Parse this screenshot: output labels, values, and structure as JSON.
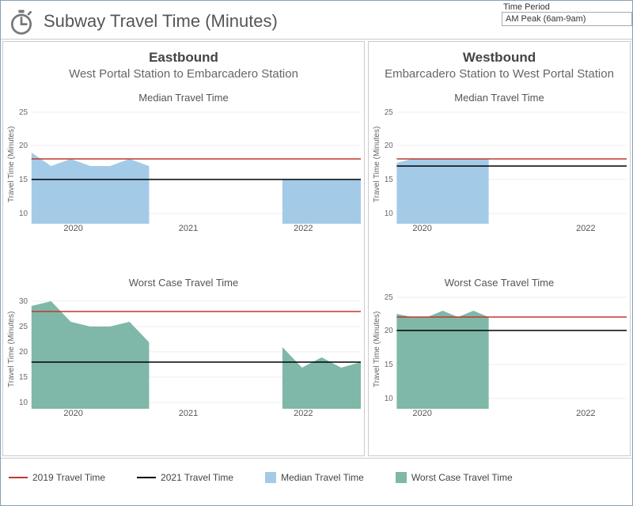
{
  "header": {
    "title": "Subway Travel Time (Minutes)",
    "icon": "stopwatch-icon"
  },
  "period": {
    "label": "Time Period",
    "value": "AM Peak (6am-9am)"
  },
  "panels": {
    "left": {
      "direction": "Eastbound",
      "route": "West Portal Station to Embarcadero Station"
    },
    "right": {
      "direction": "Westbound",
      "route": "Embarcadero Station to West Portal Station"
    }
  },
  "subplot_titles": {
    "median": "Median Travel Time",
    "worst": "Worst Case Travel Time"
  },
  "axis": {
    "y_label": "Travel Time (Minutes)",
    "x_ticks_full": [
      "2020",
      "2021",
      "2022"
    ],
    "x_ticks_clipped": [
      "2020",
      "2022"
    ]
  },
  "legend": {
    "l1": "2019 Travel Time",
    "l2": "2021 Travel Time",
    "l3": "Median Travel Time",
    "l4": "Worst Case Travel Time"
  },
  "chart_data": [
    {
      "id": "eastbound_median",
      "type": "area",
      "title": "Eastbound — Median Travel Time",
      "ylabel": "Travel Time (Minutes)",
      "ylim": [
        9,
        25
      ],
      "x": [
        2019.3,
        2019.45,
        2019.6,
        2019.75,
        2019.9,
        2020.05,
        2020.2,
        2021.4,
        2021.55,
        2021.7,
        2021.85,
        2022.0
      ],
      "series": [
        {
          "name": "Median Travel Time",
          "color": "#a3cbe8",
          "values": [
            19,
            17,
            18,
            17,
            17,
            18,
            17,
            15,
            15,
            15,
            15,
            15
          ]
        }
      ],
      "reference_lines": [
        {
          "name": "2019 Travel Time",
          "value": 18,
          "color": "#c0392b"
        },
        {
          "name": "2021 Travel Time",
          "value": 15,
          "color": "#000000"
        }
      ]
    },
    {
      "id": "eastbound_worst",
      "type": "area",
      "title": "Eastbound — Worst Case Travel Time",
      "ylabel": "Travel Time (Minutes)",
      "ylim": [
        9,
        31
      ],
      "x": [
        2019.3,
        2019.45,
        2019.6,
        2019.75,
        2019.9,
        2020.05,
        2020.2,
        2021.4,
        2021.55,
        2021.7,
        2021.85,
        2022.0
      ],
      "series": [
        {
          "name": "Worst Case Travel Time",
          "color": "#7fb8a8",
          "values": [
            29,
            30,
            26,
            25,
            25,
            26,
            22,
            21,
            17,
            19,
            17,
            18
          ]
        }
      ],
      "reference_lines": [
        {
          "name": "2019 Travel Time",
          "value": 28,
          "color": "#c0392b"
        },
        {
          "name": "2021 Travel Time",
          "value": 18,
          "color": "#000000"
        }
      ]
    },
    {
      "id": "westbound_median",
      "type": "area",
      "title": "Westbound — Median Travel Time",
      "ylabel": "Travel Time (Minutes)",
      "ylim": [
        9,
        25
      ],
      "x": [
        2019.3,
        2019.45,
        2019.6,
        2019.75,
        2019.9,
        2020.05,
        2020.2
      ],
      "series": [
        {
          "name": "Median Travel Time",
          "color": "#a3cbe8",
          "values": [
            17.5,
            18,
            18,
            18,
            18,
            18,
            18
          ]
        }
      ],
      "reference_lines": [
        {
          "name": "2019 Travel Time",
          "value": 18,
          "color": "#c0392b"
        },
        {
          "name": "2021 Travel Time",
          "value": 17,
          "color": "#000000"
        }
      ]
    },
    {
      "id": "westbound_worst",
      "type": "area",
      "title": "Westbound — Worst Case Travel Time",
      "ylabel": "Travel Time (Minutes)",
      "ylim": [
        9,
        26
      ],
      "x": [
        2019.3,
        2019.45,
        2019.6,
        2019.75,
        2019.9,
        2020.05,
        2020.2
      ],
      "series": [
        {
          "name": "Worst Case Travel Time",
          "color": "#7fb8a8",
          "values": [
            22.5,
            22,
            22,
            23,
            22,
            23,
            22
          ]
        }
      ],
      "reference_lines": [
        {
          "name": "2019 Travel Time",
          "value": 22,
          "color": "#c0392b"
        },
        {
          "name": "2021 Travel Time",
          "value": 20,
          "color": "#000000"
        }
      ]
    }
  ]
}
